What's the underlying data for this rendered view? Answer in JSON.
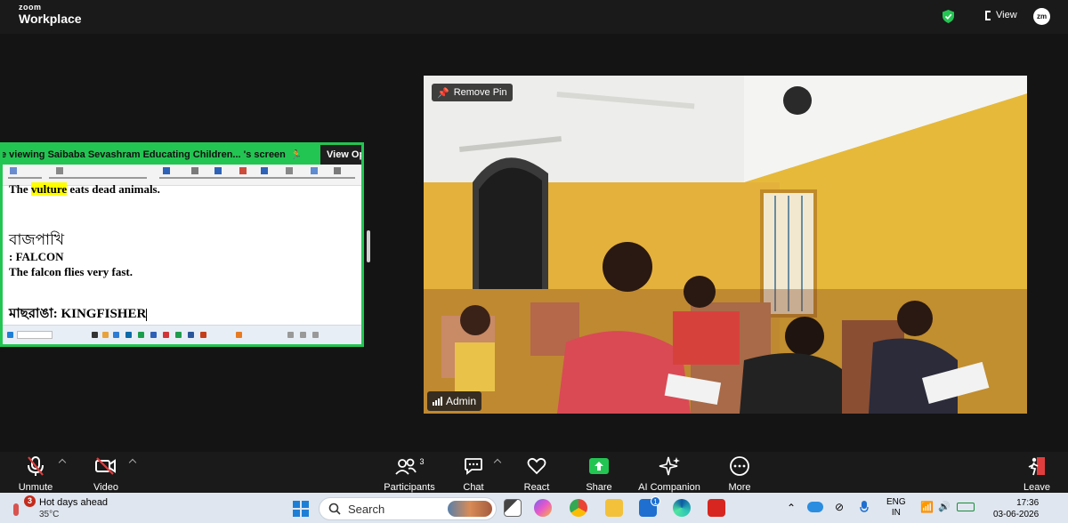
{
  "app": {
    "brand_small": "zoom",
    "brand_large": "Workplace"
  },
  "header": {
    "view_label": "View",
    "avatar_initials": "zm"
  },
  "share": {
    "banner_text": "e viewing  Saibaba Sevashram Educating Children... 's screen",
    "view_options": "View Op",
    "doc_lines": {
      "line1_pre": "The ",
      "line1_highlight": "vulture",
      "line1_post": " eats dead animals.",
      "bengali1": "বাজপাখি",
      "line3": ": FALCON",
      "line4": "The falcon flies very fast.",
      "bengali2": "মাছরাঙা: KINGFISHER"
    }
  },
  "video": {
    "pin_label": "Remove Pin",
    "participant_name": "Admin"
  },
  "toolbar": {
    "unmute": "Unmute",
    "video": "Video",
    "participants": "Participants",
    "participants_count": "3",
    "chat": "Chat",
    "react": "React",
    "share": "Share",
    "ai_companion": "AI Companion",
    "more": "More",
    "leave": "Leave"
  },
  "taskbar": {
    "weather_badge": "3",
    "weather_title": "Hot days ahead",
    "weather_temp": "35°C",
    "search_placeholder": "Search",
    "store_badge": "1",
    "lang_top": "ENG",
    "lang_bottom": "IN",
    "time": "17:36",
    "date": "03-06-2026"
  },
  "colors": {
    "share_green": "#23c552",
    "accent_blue": "#1e7fd6"
  }
}
